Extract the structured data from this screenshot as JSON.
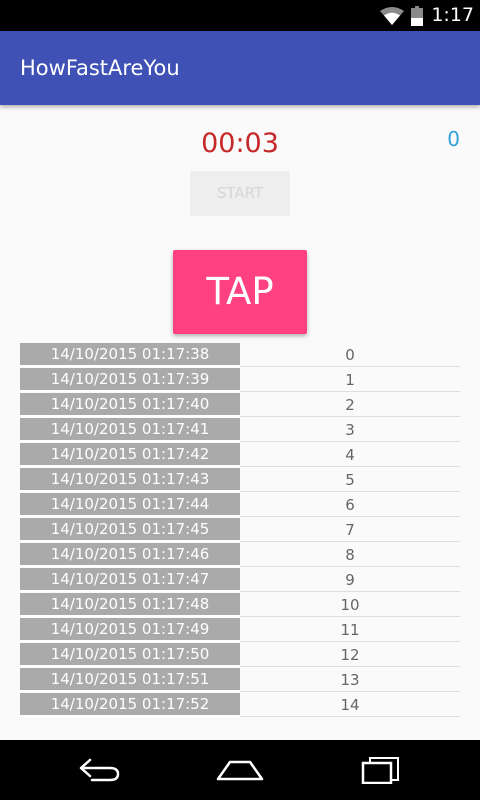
{
  "status_bar": {
    "time": "1:17",
    "icons": [
      "wifi-icon",
      "battery-icon"
    ]
  },
  "app_bar": {
    "title": "HowFastAreYou",
    "color": "#3f51b5"
  },
  "timer": {
    "value": "00:03",
    "color": "#c62828"
  },
  "counter": {
    "value": "0",
    "color": "#33a1d9"
  },
  "start_button": {
    "label": "START",
    "enabled": false
  },
  "tap_button": {
    "label": "TAP",
    "color": "#ff4081"
  },
  "history": [
    {
      "timestamp": "14/10/2015 01:17:38",
      "value": "0"
    },
    {
      "timestamp": "14/10/2015 01:17:39",
      "value": "1"
    },
    {
      "timestamp": "14/10/2015 01:17:40",
      "value": "2"
    },
    {
      "timestamp": "14/10/2015 01:17:41",
      "value": "3"
    },
    {
      "timestamp": "14/10/2015 01:17:42",
      "value": "4"
    },
    {
      "timestamp": "14/10/2015 01:17:43",
      "value": "5"
    },
    {
      "timestamp": "14/10/2015 01:17:44",
      "value": "6"
    },
    {
      "timestamp": "14/10/2015 01:17:45",
      "value": "7"
    },
    {
      "timestamp": "14/10/2015 01:17:46",
      "value": "8"
    },
    {
      "timestamp": "14/10/2015 01:17:47",
      "value": "9"
    },
    {
      "timestamp": "14/10/2015 01:17:48",
      "value": "10"
    },
    {
      "timestamp": "14/10/2015 01:17:49",
      "value": "11"
    },
    {
      "timestamp": "14/10/2015 01:17:50",
      "value": "12"
    },
    {
      "timestamp": "14/10/2015 01:17:51",
      "value": "13"
    },
    {
      "timestamp": "14/10/2015 01:17:52",
      "value": "14"
    }
  ],
  "nav_bar": {
    "buttons": [
      "back-icon",
      "home-icon",
      "recents-icon"
    ]
  }
}
